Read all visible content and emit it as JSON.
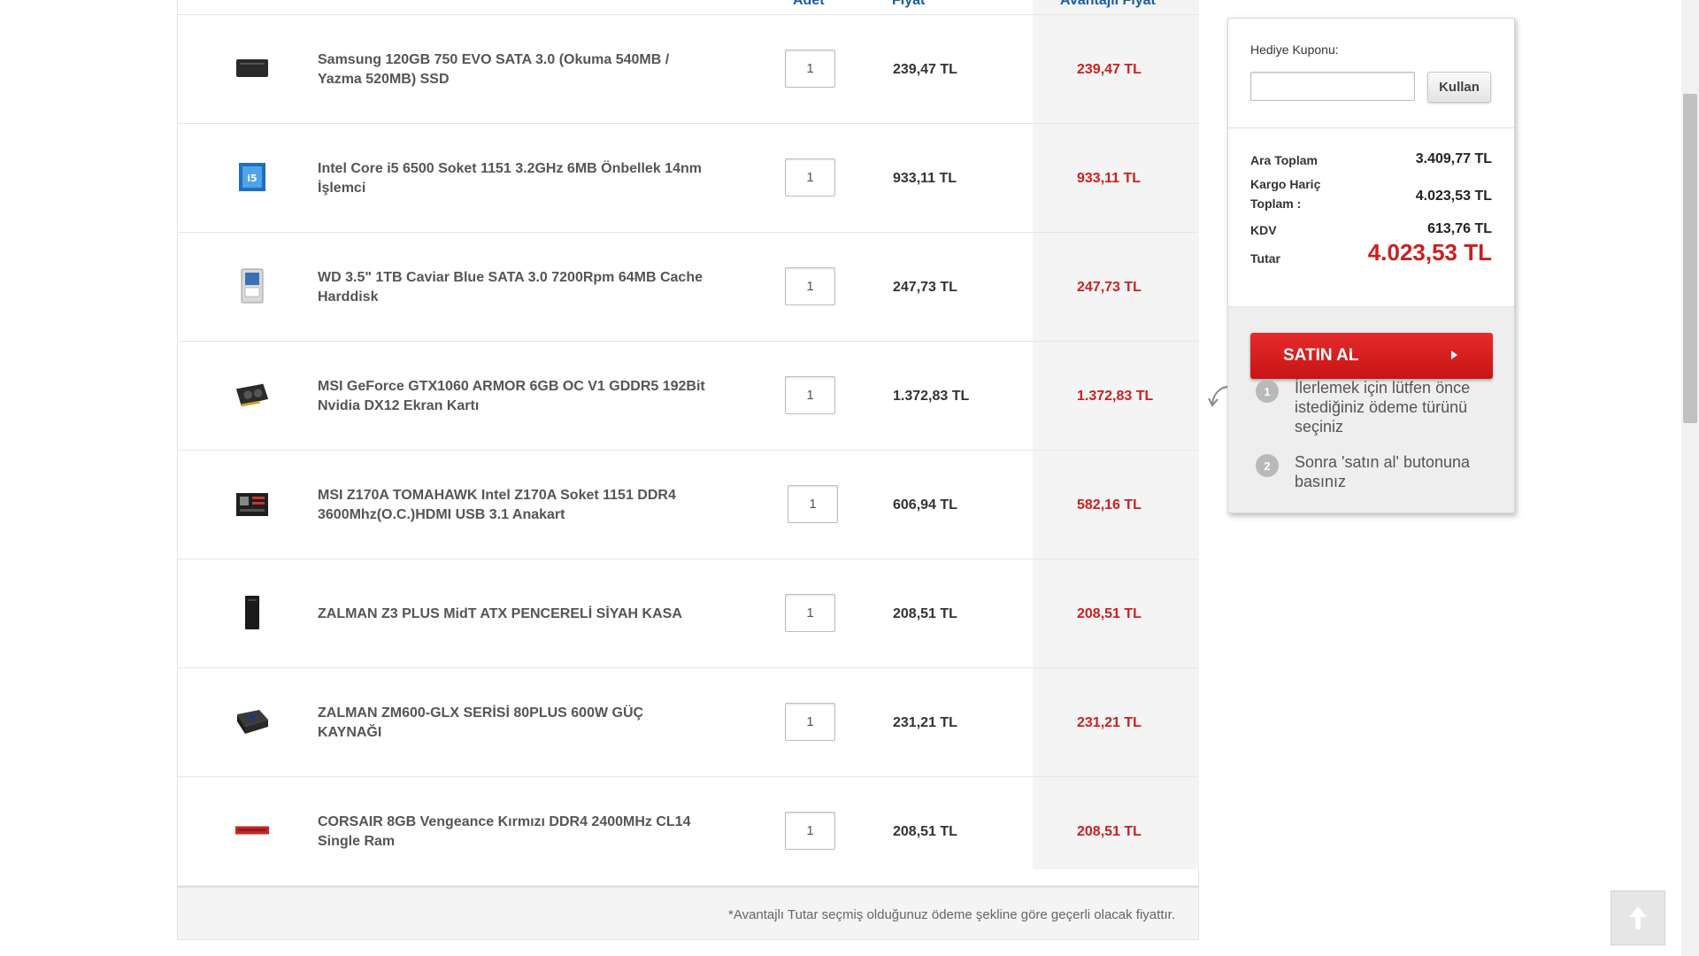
{
  "table": {
    "headers": {
      "qty": "Adet",
      "price": "Fiyat",
      "advantage_price": "Avantajlı Fiyat"
    },
    "items": [
      {
        "name": "Samsung 120GB 750 EVO SATA 3.0 (Okuma 540MB / Yazma 520MB) SSD",
        "qty": "1",
        "price": "239,47 TL",
        "advantage_price": "239,47 TL",
        "icon": "ssd-icon"
      },
      {
        "name": "Intel Core i5 6500 Soket 1151 3.2GHz 6MB Önbellek 14nm İşlemci",
        "qty": "1",
        "price": "933,11 TL",
        "advantage_price": "933,11 TL",
        "icon": "cpu-box-icon"
      },
      {
        "name": "WD 3.5\" 1TB Caviar Blue SATA 3.0 7200Rpm 64MB Cache Harddisk",
        "qty": "1",
        "price": "247,73 TL",
        "advantage_price": "247,73 TL",
        "icon": "hard-drive-icon"
      },
      {
        "name": "MSI GeForce GTX1060 ARMOR 6GB OC V1 GDDR5 192Bit Nvidia DX12 Ekran Kartı",
        "qty": "1",
        "price": "1.372,83 TL",
        "advantage_price": "1.372,83 TL",
        "icon": "graphics-card-icon"
      },
      {
        "name": "MSI Z170A TOMAHAWK Intel Z170A Soket 1151 DDR4 3600Mhz(O.C.)HDMI USB 3.1 Anakart",
        "qty": "1",
        "price": "606,94 TL",
        "advantage_price": "582,16 TL",
        "icon": "motherboard-icon"
      },
      {
        "name": "ZALMAN Z3 PLUS MidT ATX PENCERELİ SİYAH KASA",
        "qty": "1",
        "price": "208,51 TL",
        "advantage_price": "208,51 TL",
        "icon": "pc-case-icon"
      },
      {
        "name": "ZALMAN ZM600-GLX SERİSİ 80PLUS 600W GÜÇ KAYNAĞI",
        "qty": "1",
        "price": "231,21 TL",
        "advantage_price": "231,21 TL",
        "icon": "power-supply-icon"
      },
      {
        "name": "CORSAIR 8GB Vengeance Kırmızı DDR4 2400MHz CL14 Single Ram",
        "qty": "1",
        "price": "208,51 TL",
        "advantage_price": "208,51 TL",
        "icon": "ram-stick-icon"
      }
    ],
    "footnote": "*Avantajlı Tutar seçmiş olduğunuz ödeme şekline göre geçerli olacak fiyattır."
  },
  "summary": {
    "coupon_label": "Hediye Kuponu:",
    "coupon_value": "",
    "coupon_button": "Kullan",
    "subtotal_label": "Ara Toplam",
    "subtotal_value": "3.409,77 TL",
    "ex_shipping_label": "Kargo Hariç Toplam :",
    "ex_shipping_value": "4.023,53 TL",
    "vat_label": "KDV",
    "vat_value": "613,76 TL",
    "total_label": "Tutar",
    "total_value": "4.023,53 TL",
    "buy_button": "SATIN AL",
    "steps": [
      {
        "num": "1",
        "text": "İlerlemek için lütfen önce istediğiniz ödeme türünü seçiniz"
      },
      {
        "num": "2",
        "text": "Sonra 'satın al' butonuna basınız"
      }
    ]
  },
  "colors": {
    "accent_red": "#cc1f1f",
    "header_blue": "#1a5ea0"
  }
}
